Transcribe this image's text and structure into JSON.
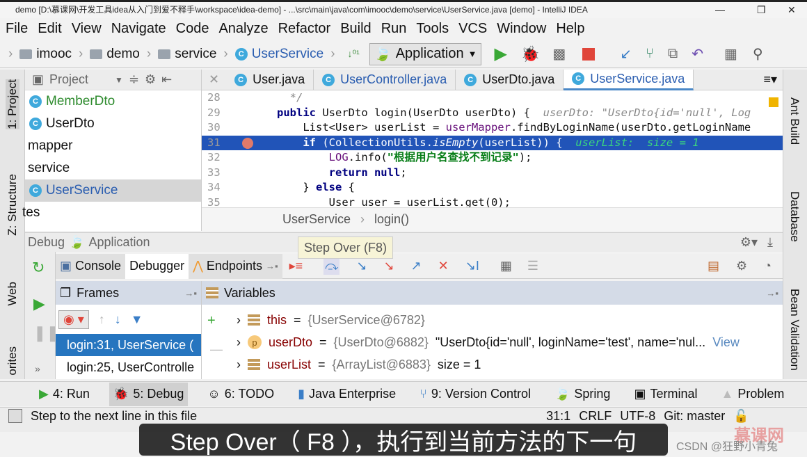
{
  "window": {
    "title": "demo [D:\\慕课网\\开发工具idea从入门到爱不释手\\workspace\\idea-demo] - ...\\src\\main\\java\\com\\imooc\\demo\\service\\UserService.java [demo] - IntelliJ IDEA",
    "min": "—",
    "max": "❐",
    "close": "✕"
  },
  "menu": [
    "File",
    "Edit",
    "View",
    "Navigate",
    "Code",
    "Analyze",
    "Refactor",
    "Build",
    "Run",
    "Tools",
    "VCS",
    "Window",
    "Help"
  ],
  "nav": {
    "crumbs": [
      "imooc",
      "demo",
      "service",
      "UserService"
    ],
    "run_config": "Application"
  },
  "project": {
    "title": "Project",
    "items": [
      {
        "label": "MemberDto",
        "type": "class"
      },
      {
        "label": "UserDto",
        "type": "class"
      },
      {
        "label": "mapper",
        "type": "package"
      },
      {
        "label": "service",
        "type": "package"
      },
      {
        "label": "UserService",
        "type": "class",
        "selected": true
      },
      {
        "label": "tes",
        "type": "package"
      }
    ]
  },
  "left_strip": [
    "1: Project",
    "Z: Structure",
    "Web",
    "orites"
  ],
  "right_strip": [
    "Ant Build",
    "Database",
    "Bean Validation"
  ],
  "tabs": [
    {
      "label": "User.java"
    },
    {
      "label": "UserController.java"
    },
    {
      "label": "UserDto.java"
    },
    {
      "label": "UserService.java",
      "active": true
    }
  ],
  "editor": {
    "lines": [
      {
        "n": "28",
        "html_parts": [
          {
            "t": "  */",
            "c": "hint"
          }
        ]
      },
      {
        "n": "29",
        "html_parts": [
          {
            "t": "public ",
            "c": "kw"
          },
          {
            "t": "UserDto login(UserDto userDto) {  ",
            "c": ""
          },
          {
            "t": "userDto: \"UserDto{id='null', Log",
            "c": "hint"
          }
        ]
      },
      {
        "n": "30",
        "html_parts": [
          {
            "t": "    List<User> userList = ",
            "c": ""
          },
          {
            "t": "userMapper",
            "c": "fld"
          },
          {
            "t": ".findByLoginName(userDto.getLoginName",
            "c": ""
          }
        ]
      },
      {
        "n": "31",
        "hl": true,
        "html_parts": [
          {
            "t": "    if ",
            "c": "kw"
          },
          {
            "t": "(CollectionUtils.",
            "c": ""
          },
          {
            "t": "isEmpty",
            "c": "hint2"
          },
          {
            "t": "(userList)) {  ",
            "c": ""
          },
          {
            "t": "userList:  size = 1",
            "c": "hint"
          }
        ]
      },
      {
        "n": "32",
        "html_parts": [
          {
            "t": "        ",
            "c": ""
          },
          {
            "t": "LOG",
            "c": "fld"
          },
          {
            "t": ".info(",
            "c": ""
          },
          {
            "t": "\"根据用户名查找不到记录\"",
            "c": "str"
          },
          {
            "t": ");",
            "c": ""
          }
        ]
      },
      {
        "n": "33",
        "html_parts": [
          {
            "t": "        return null",
            "c": "kw"
          },
          {
            "t": ";",
            "c": ""
          }
        ]
      },
      {
        "n": "34",
        "html_parts": [
          {
            "t": "    } ",
            "c": ""
          },
          {
            "t": "else ",
            "c": "kw"
          },
          {
            "t": "{",
            "c": ""
          }
        ]
      },
      {
        "n": "35",
        "html_parts": [
          {
            "t": "        User user = userList.get(0);",
            "c": ""
          }
        ]
      }
    ]
  },
  "editor_crumbs": [
    "UserService",
    "login()"
  ],
  "debug": {
    "label": "Debug",
    "config": "Application",
    "tooltip": "Step Over (F8)",
    "tabs": [
      "Console",
      "Debugger",
      "Endpoints"
    ],
    "active_tab": "Debugger",
    "frames_title": "Frames",
    "variables_title": "Variables",
    "frames": [
      {
        "label": "login:31, UserService (",
        "selected": true
      },
      {
        "label": "login:25, UserControlle"
      }
    ],
    "variables": [
      {
        "name": "this",
        "value": "{UserService@6782}",
        "extra": "",
        "icon": "field"
      },
      {
        "name": "userDto",
        "value": "{UserDto@6882}",
        "extra": "\"UserDto{id='null', loginName='test', name='nul...",
        "link": "View",
        "icon": "param"
      },
      {
        "name": "userList",
        "value": "{ArrayList@6883}",
        "extra": "size = 1",
        "icon": "field"
      }
    ]
  },
  "bottom_tools": [
    {
      "label": "4: Run"
    },
    {
      "label": "5: Debug",
      "active": true
    },
    {
      "label": "6: TODO"
    },
    {
      "label": "Java Enterprise"
    },
    {
      "label": "9: Version Control"
    },
    {
      "label": "Spring"
    },
    {
      "label": "Terminal"
    },
    {
      "label": "Problem"
    }
  ],
  "status": {
    "message": "Step to the next line in this file",
    "position": "31:1",
    "line_sep": "CRLF",
    "encoding": "UTF-8",
    "git": "Git: master"
  },
  "subtitle": "Step Over（ F8 ），执行到当前方法的下一句",
  "watermark": "CSDN @狂野小青兔",
  "watermark_logo": "慕课网",
  "colors": {
    "accent": "#2154b8",
    "selection": "#2675bf",
    "frames_header": "#d4dbe7",
    "run_green": "#3aa836",
    "stop_red": "#e0453a"
  }
}
